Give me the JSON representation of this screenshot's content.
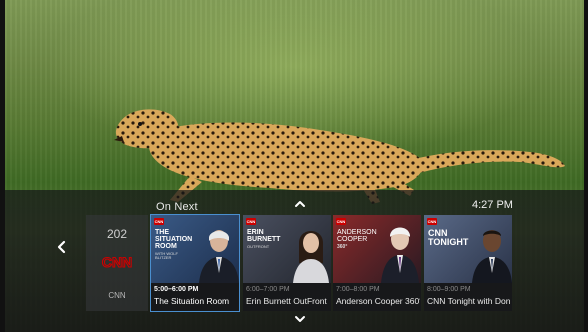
{
  "guide": {
    "header_label": "On Next",
    "clock": "4:27 PM"
  },
  "channel": {
    "number": "202",
    "logo_text": "CNN",
    "name": "CNN",
    "logo_color": "#cc0000"
  },
  "programs": [
    {
      "art_title_lines": "THE SITUATION ROOM",
      "art_subtitle": "WITH WOLF BLITZER",
      "time": "5:00–6:00 PM",
      "title": "The Situation Room",
      "selected": true
    },
    {
      "art_title_lines": "ERIN BURNETT",
      "art_subtitle": "OUTFRONT",
      "time": "6:00–7:00 PM",
      "title": "Erin Burnett OutFront",
      "selected": false
    },
    {
      "art_title_lines": "ANDERSON COOPER",
      "art_subtitle": "360°",
      "time": "7:00–8:00 PM",
      "title": "Anderson Cooper 360°",
      "selected": false
    },
    {
      "art_title_lines": "CNN TONIGHT",
      "art_subtitle": "",
      "time": "8:00–9:00 PM",
      "title": "CNN Tonight with Don Lemon",
      "selected": false
    }
  ],
  "badge_text": "CNN",
  "colors": {
    "selection": "#4a8fcf",
    "brand_red": "#cc0000"
  },
  "icons": {
    "up": "chevron-up-icon",
    "down": "chevron-down-icon",
    "left": "chevron-left-icon"
  }
}
